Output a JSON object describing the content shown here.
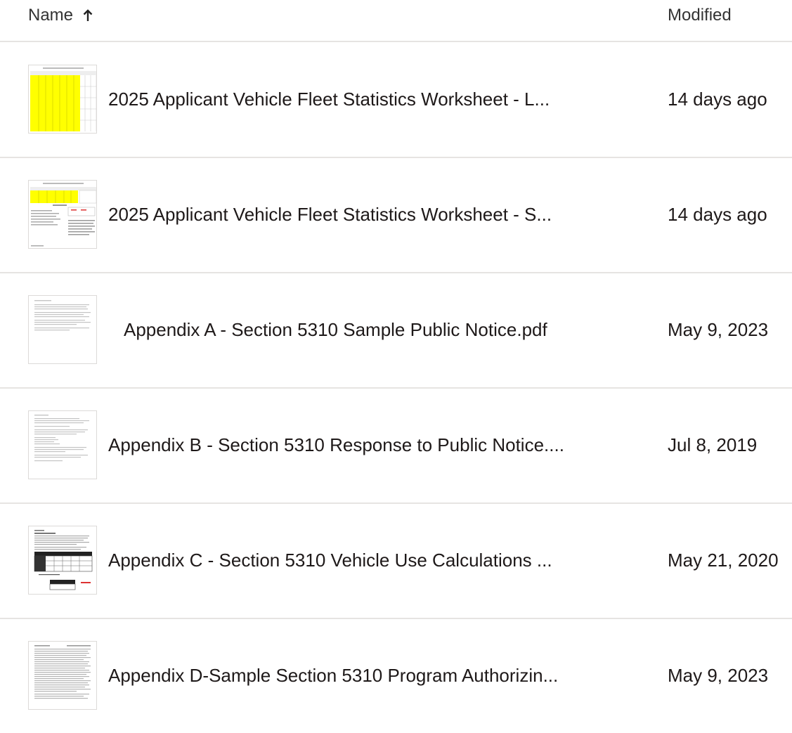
{
  "header": {
    "name_label": "Name",
    "sort_icon": "arrow-up-icon",
    "modified_label": "Modified"
  },
  "files": [
    {
      "name": "2025 Applicant Vehicle Fleet Statistics Worksheet - L...",
      "modified": "14 days ago",
      "thumbnail": "spreadsheet-yellow-thumbnail"
    },
    {
      "name": "2025 Applicant Vehicle Fleet Statistics Worksheet - S...",
      "modified": "14 days ago",
      "thumbnail": "spreadsheet-summary-thumbnail"
    },
    {
      "name": "Appendix A - Section 5310 Sample Public Notice.pdf",
      "modified": "May 9, 2023",
      "thumbnail": "text-document-thumbnail"
    },
    {
      "name": "Appendix B - Section 5310 Response to Public Notice....",
      "modified": "Jul 8, 2019",
      "thumbnail": "text-document-thumbnail"
    },
    {
      "name": "Appendix C - Section 5310 Vehicle Use Calculations ...",
      "modified": "May 21, 2020",
      "thumbnail": "table-document-thumbnail"
    },
    {
      "name": "Appendix D-Sample Section 5310 Program Authorizin...",
      "modified": "May 9, 2023",
      "thumbnail": "text-document-thumbnail"
    }
  ],
  "colors": {
    "highlight_yellow": "#ffff00",
    "divider": "#e6e4e2",
    "text": "#1e1919"
  }
}
